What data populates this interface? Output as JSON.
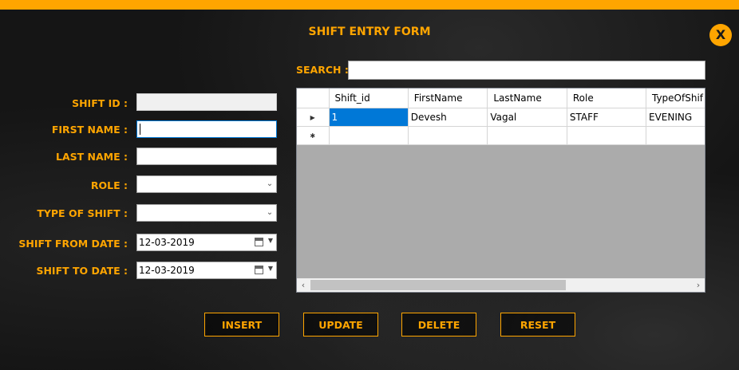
{
  "window": {
    "title": "SHIFT ENTRY FORM",
    "close_label": "X",
    "accent_color": "#FFA500"
  },
  "form": {
    "shift_id_label": "SHIFT ID :",
    "first_name_label": "FIRST NAME :",
    "last_name_label": "LAST NAME :",
    "role_label": "ROLE :",
    "type_of_shift_label": "TYPE OF SHIFT :",
    "shift_from_date_label": "SHIFT FROM DATE :",
    "shift_to_date_label": "SHIFT TO DATE :",
    "shift_id_value": "",
    "first_name_value": "",
    "last_name_value": "",
    "role_value": "",
    "type_of_shift_value": "",
    "shift_from_date_value": "12-03-2019",
    "shift_to_date_value": "12-03-2019"
  },
  "search": {
    "label": "SEARCH :",
    "value": ""
  },
  "grid": {
    "columns": [
      "Shift_id",
      "FirstName",
      "LastName",
      "Role",
      "TypeOfShif"
    ],
    "rows": [
      {
        "Shift_id": "1",
        "FirstName": "Devesh",
        "LastName": "Vagal",
        "Role": "STAFF",
        "TypeOfShift": "EVENING"
      }
    ]
  },
  "buttons": {
    "insert": "INSERT",
    "update": "UPDATE",
    "delete": "DELETE",
    "reset": "RESET"
  }
}
